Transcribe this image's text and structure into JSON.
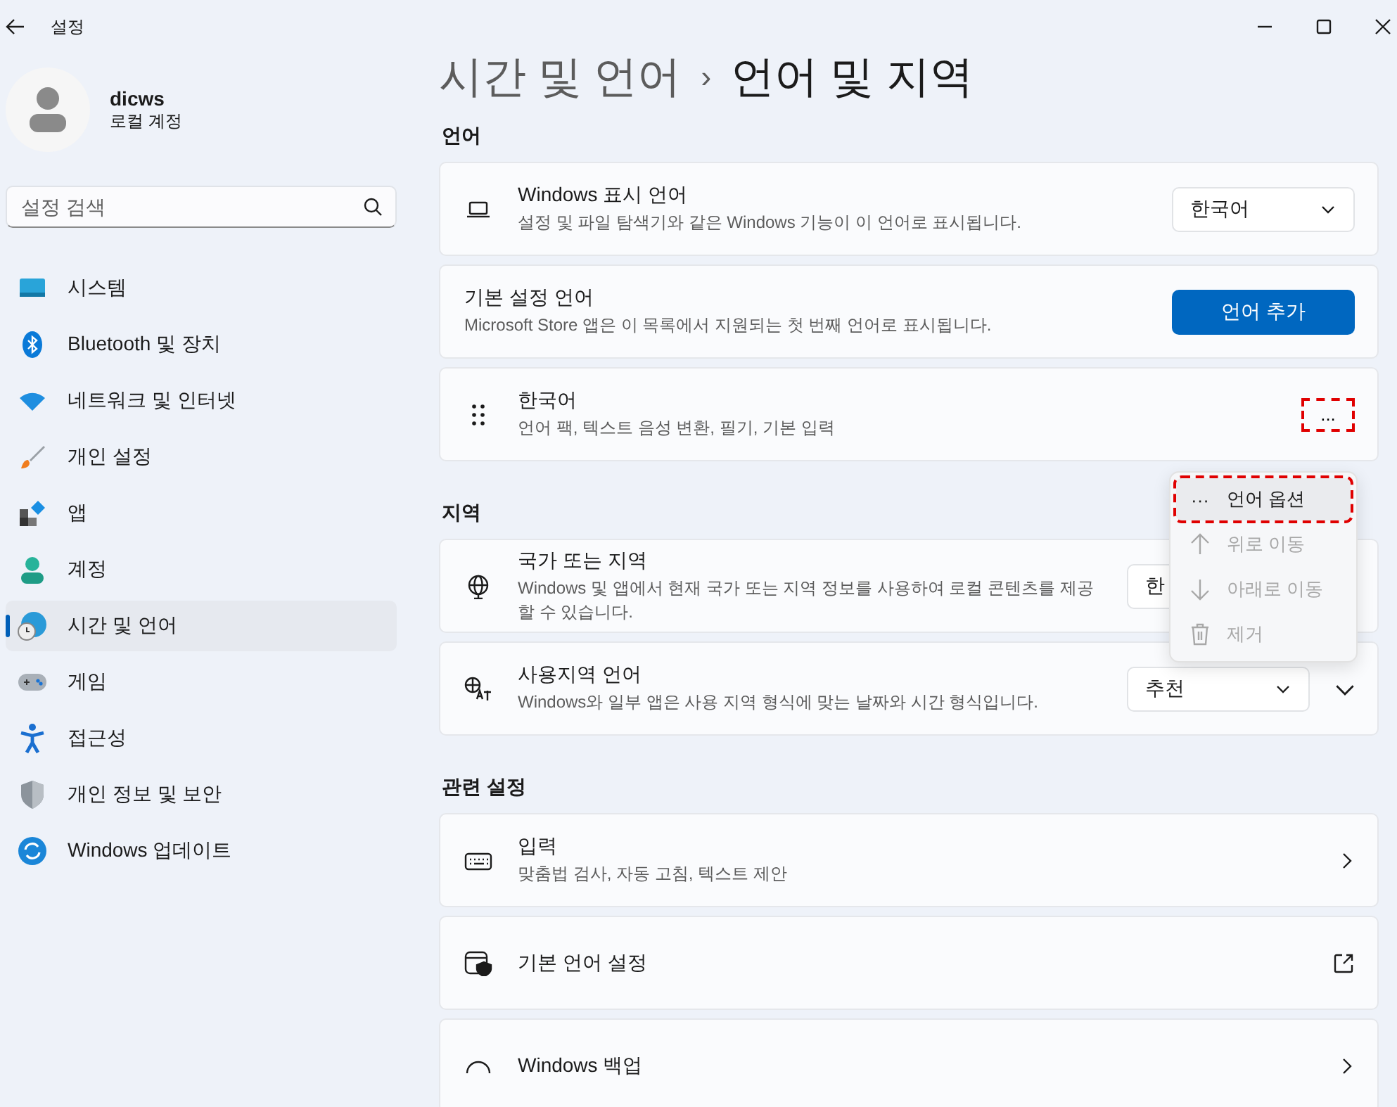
{
  "window": {
    "title": "설정"
  },
  "account": {
    "name": "dicws",
    "type": "로컬 계정"
  },
  "search": {
    "placeholder": "설정 검색"
  },
  "sidebar": {
    "items": [
      {
        "label": "시스템",
        "selected": false
      },
      {
        "label": "Bluetooth 및 장치",
        "selected": false
      },
      {
        "label": "네트워크 및 인터넷",
        "selected": false
      },
      {
        "label": "개인 설정",
        "selected": false
      },
      {
        "label": "앱",
        "selected": false
      },
      {
        "label": "계정",
        "selected": false
      },
      {
        "label": "시간 및 언어",
        "selected": true
      },
      {
        "label": "게임",
        "selected": false
      },
      {
        "label": "접근성",
        "selected": false
      },
      {
        "label": "개인 정보 및 보안",
        "selected": false
      },
      {
        "label": "Windows 업데이트",
        "selected": false
      }
    ]
  },
  "breadcrumb": {
    "parent": "시간 및 언어",
    "separator": "›",
    "current": "언어 및 지역"
  },
  "sections": [
    {
      "heading": "언어",
      "cards": [
        {
          "kind": "dropdown",
          "title": "Windows 표시 언어",
          "description": "설정 및 파일 탐색기와 같은 Windows 기능이 이 언어로 표시됩니다.",
          "value": "한국어"
        },
        {
          "kind": "button",
          "title": "기본 설정 언어",
          "description": "Microsoft Store 앱은 이 목록에서 지원되는 첫 번째 언어로 표시됩니다.",
          "button": "언어 추가"
        },
        {
          "kind": "language",
          "title": "한국어",
          "description": "언어 팩, 텍스트 음성 변환, 필기, 기본 입력",
          "more": "...",
          "highlighted": true
        }
      ]
    },
    {
      "heading": "지역",
      "cards": [
        {
          "kind": "dropdown",
          "title": "국가 또는 지역",
          "description": "Windows 및 앱에서 현재 국가 또는 지역 정보를 사용하여 로컬 콘텐츠를 제공할 수 있습니다.",
          "value": "한",
          "expandable": false
        },
        {
          "kind": "dropdown",
          "title": "사용지역 언어",
          "description": "Windows와 일부 앱은 사용 지역 형식에 맞는 날짜와 시간 형식입니다.",
          "value": "추천",
          "expandable": true
        }
      ]
    },
    {
      "heading": "관련 설정",
      "cards": [
        {
          "kind": "link",
          "title": "입력",
          "description": "맞춤법 검사, 자동 고침, 텍스트 제안"
        },
        {
          "kind": "external",
          "title": "기본 언어 설정"
        },
        {
          "kind": "link",
          "title": "Windows 백업"
        }
      ]
    }
  ],
  "context_menu": {
    "items": [
      {
        "label": "언어 옵션",
        "prefix": "···",
        "disabled": false,
        "highlighted": true
      },
      {
        "label": "위로 이동",
        "disabled": true,
        "highlighted": false
      },
      {
        "label": "아래로 이동",
        "disabled": true,
        "highlighted": false
      },
      {
        "label": "제거",
        "disabled": true,
        "highlighted": false
      }
    ]
  }
}
